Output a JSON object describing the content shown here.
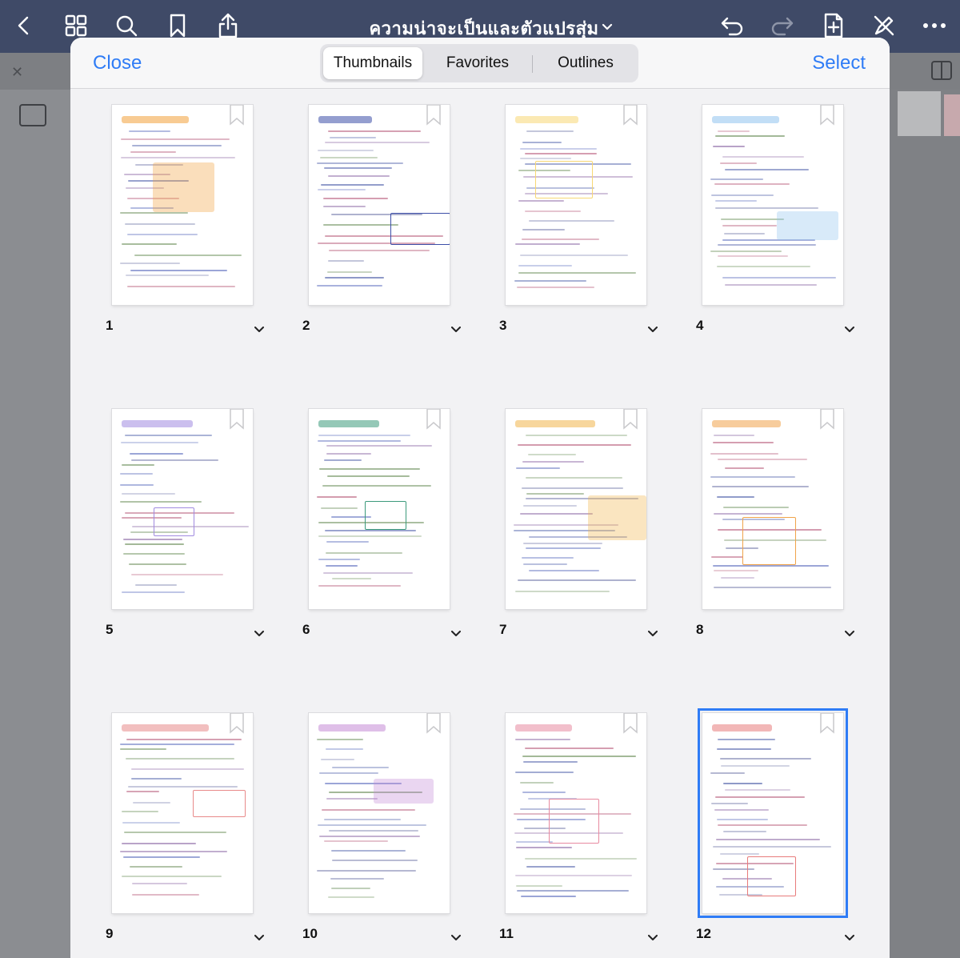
{
  "toolbar": {
    "title": "ความน่าจะเป็นและตัวแปรสุ่ม",
    "icons": [
      "back-icon",
      "grid-icon",
      "search-icon",
      "bookmark-icon",
      "share-icon",
      "undo-icon",
      "redo-icon",
      "add-page-icon",
      "pen-off-icon",
      "more-icon"
    ]
  },
  "sheet": {
    "close_label": "Close",
    "select_label": "Select",
    "tabs": [
      {
        "label": "Thumbnails",
        "active": true
      },
      {
        "label": "Favorites",
        "active": false
      },
      {
        "label": "Outlines",
        "active": false
      }
    ]
  },
  "thumbnails": [
    {
      "number": "1",
      "accent": "#f2a03b",
      "selected": false
    },
    {
      "number": "2",
      "accent": "#3d4fa8",
      "selected": false
    },
    {
      "number": "3",
      "accent": "#f7d774",
      "selected": false
    },
    {
      "number": "4",
      "accent": "#8fc3ee",
      "selected": false
    },
    {
      "number": "5",
      "accent": "#a08be0",
      "selected": false
    },
    {
      "number": "6",
      "accent": "#3c9a7c",
      "selected": false
    },
    {
      "number": "7",
      "accent": "#f0b44a",
      "selected": false
    },
    {
      "number": "8",
      "accent": "#f0a34a",
      "selected": false
    },
    {
      "number": "9",
      "accent": "#e88a8a",
      "selected": false
    },
    {
      "number": "10",
      "accent": "#c48ad6",
      "selected": false
    },
    {
      "number": "11",
      "accent": "#e88aa0",
      "selected": false
    },
    {
      "number": "12",
      "accent": "#e87b7b",
      "selected": true
    }
  ],
  "colors": {
    "appbar": "#3f4a67",
    "accent_blue": "#2f7cf6"
  }
}
